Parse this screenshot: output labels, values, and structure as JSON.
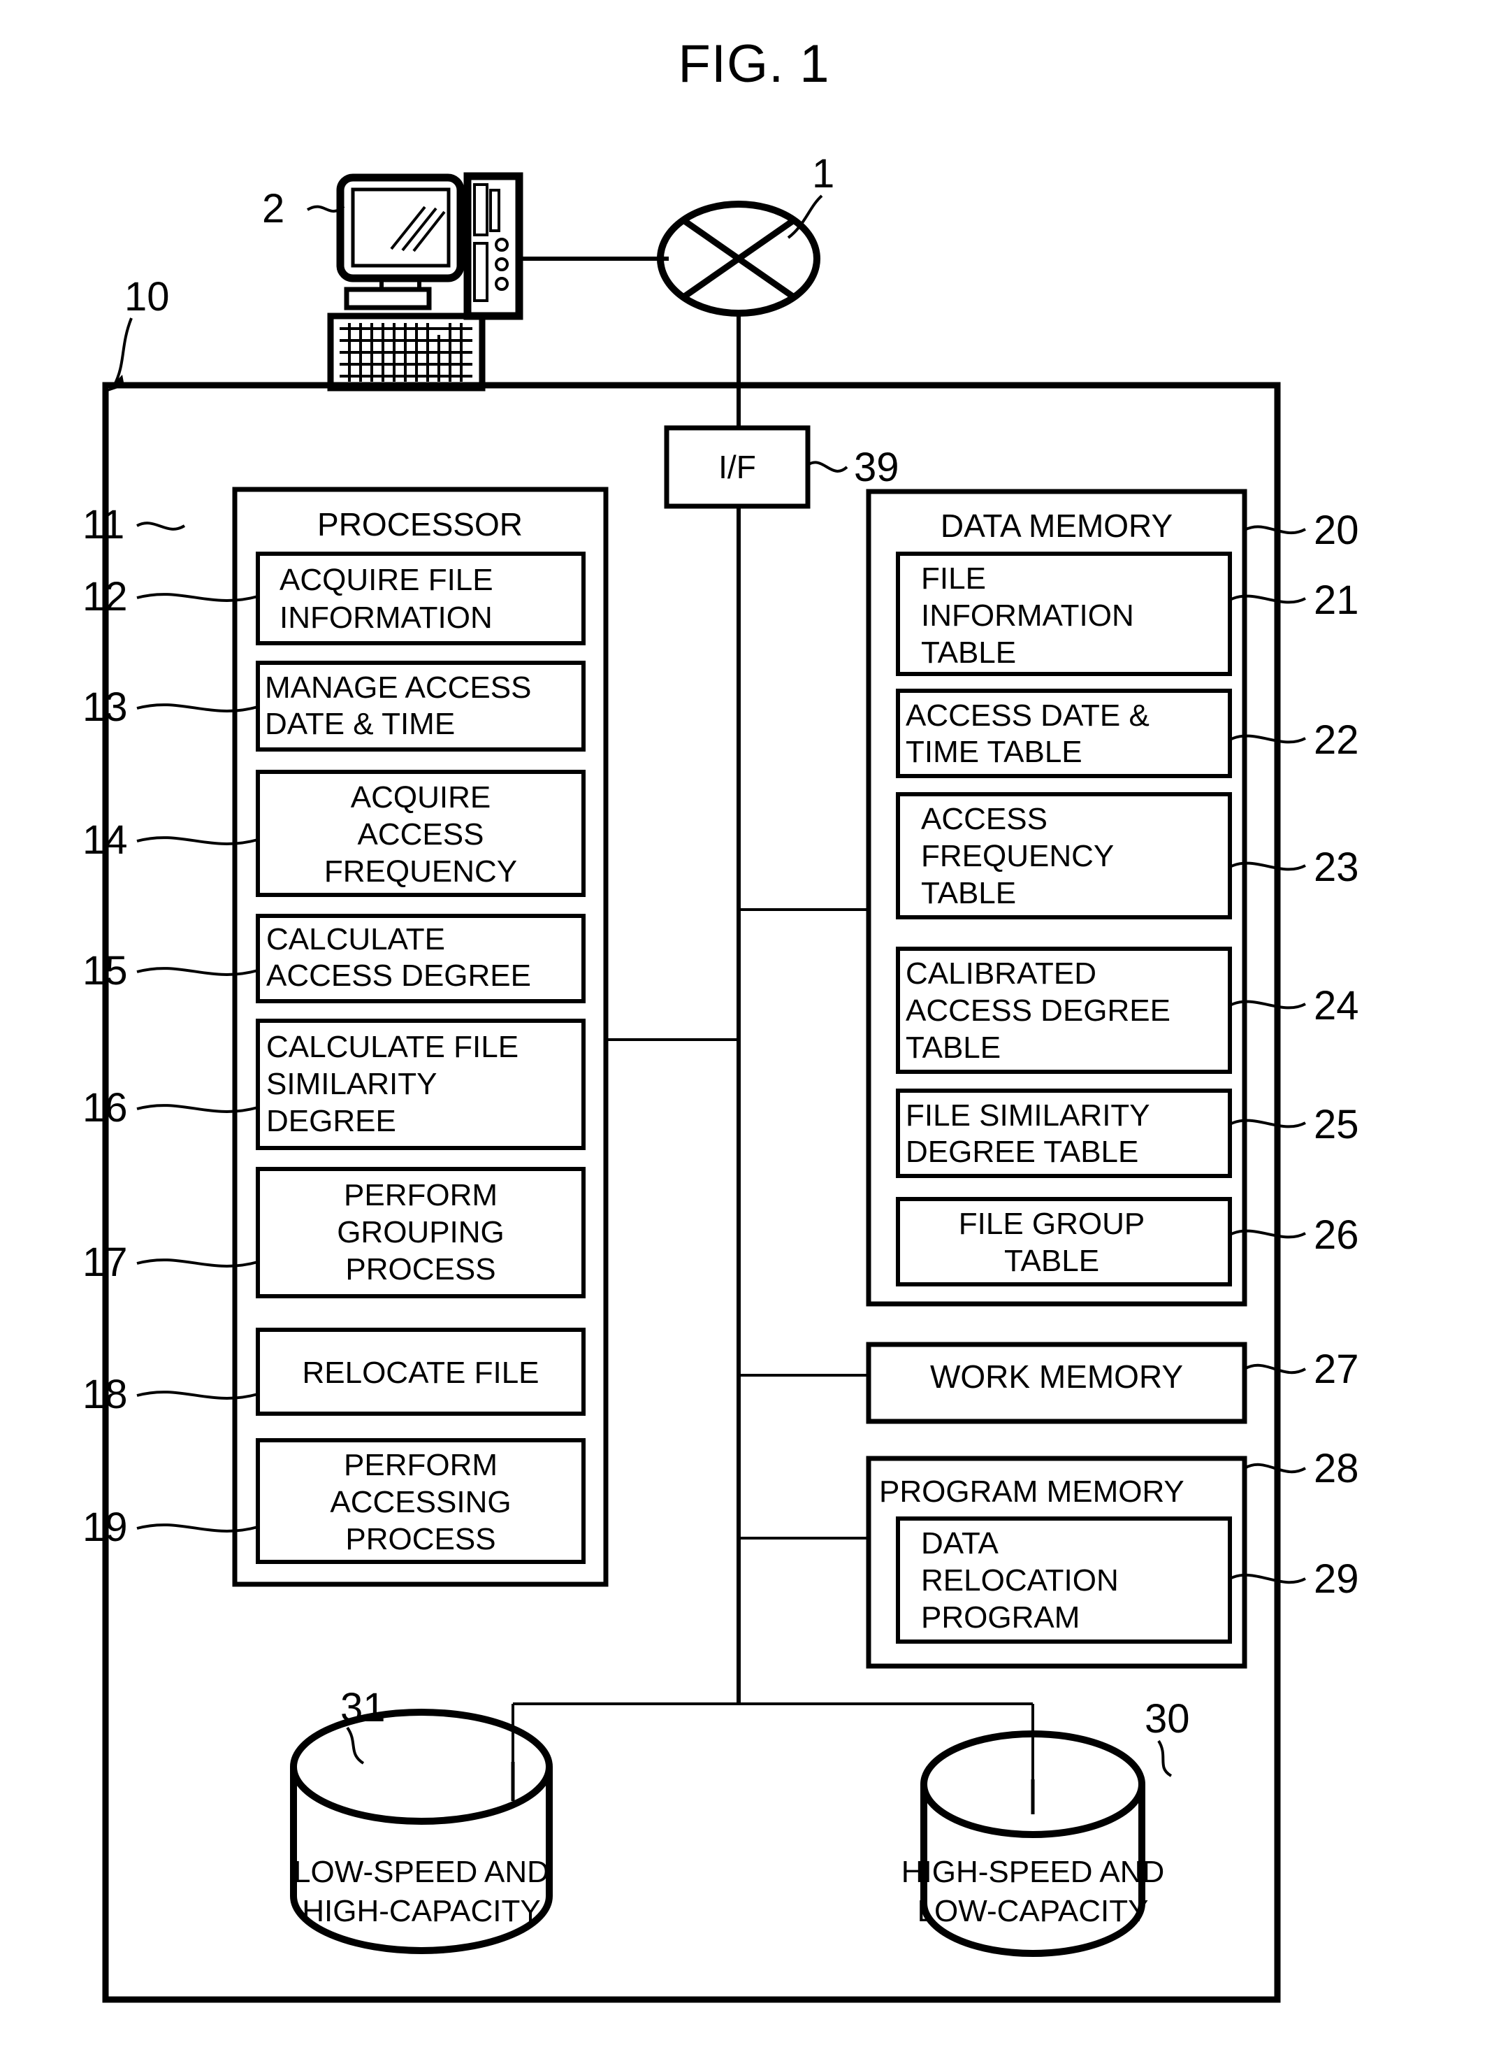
{
  "figure": {
    "title": "FIG. 1"
  },
  "refs": {
    "network": "1",
    "terminal": "2",
    "system": "10",
    "processor": "11",
    "acquire_file_information": "12",
    "manage_access_date_time": "13",
    "acquire_access_frequency": "14",
    "calculate_access_degree": "15",
    "calculate_file_similarity_degree": "16",
    "perform_grouping_process": "17",
    "relocate_file": "18",
    "perform_accessing_process": "19",
    "data_memory": "20",
    "file_information_table": "21",
    "access_date_time_table": "22",
    "access_frequency_table": "23",
    "calibrated_access_degree_table": "24",
    "file_similarity_degree_table": "25",
    "file_group_table": "26",
    "work_memory": "27",
    "program_memory": "28",
    "data_relocation_program": "29",
    "high_speed_storage": "30",
    "low_speed_storage": "31",
    "interface": "39"
  },
  "interface": {
    "label": "I/F"
  },
  "processor": {
    "heading": "PROCESSOR",
    "blocks": [
      {
        "ref": "12",
        "lines": [
          "ACQUIRE FILE",
          "INFORMATION"
        ],
        "align": "left"
      },
      {
        "ref": "13",
        "lines": [
          "MANAGE ACCESS",
          "DATE & TIME"
        ],
        "align": "left"
      },
      {
        "ref": "14",
        "lines": [
          "ACQUIRE",
          "ACCESS",
          "FREQUENCY"
        ],
        "align": "center"
      },
      {
        "ref": "15",
        "lines": [
          "CALCULATE",
          "ACCESS DEGREE"
        ],
        "align": "left"
      },
      {
        "ref": "16",
        "lines": [
          "CALCULATE FILE",
          "SIMILARITY",
          "DEGREE"
        ],
        "align": "left"
      },
      {
        "ref": "17",
        "lines": [
          "PERFORM",
          "GROUPING",
          "PROCESS"
        ],
        "align": "center"
      },
      {
        "ref": "18",
        "lines": [
          "RELOCATE FILE"
        ],
        "align": "center"
      },
      {
        "ref": "19",
        "lines": [
          "PERFORM",
          "ACCESSING",
          "PROCESS"
        ],
        "align": "center"
      }
    ]
  },
  "data_memory": {
    "heading": "DATA MEMORY",
    "blocks": [
      {
        "ref": "21",
        "lines": [
          "FILE",
          "INFORMATION",
          "TABLE"
        ],
        "align": "left"
      },
      {
        "ref": "22",
        "lines": [
          "ACCESS DATE &",
          "TIME TABLE"
        ],
        "align": "left"
      },
      {
        "ref": "23",
        "lines": [
          "ACCESS",
          "FREQUENCY",
          "TABLE"
        ],
        "align": "left"
      },
      {
        "ref": "24",
        "lines": [
          "CALIBRATED",
          "ACCESS DEGREE",
          "TABLE"
        ],
        "align": "left"
      },
      {
        "ref": "25",
        "lines": [
          "FILE SIMILARITY",
          "DEGREE TABLE"
        ],
        "align": "left"
      },
      {
        "ref": "26",
        "lines": [
          "FILE GROUP",
          "TABLE"
        ],
        "align": "center"
      }
    ]
  },
  "work_memory": {
    "label": "WORK MEMORY"
  },
  "program_memory": {
    "heading": "PROGRAM MEMORY",
    "block": {
      "ref": "29",
      "lines": [
        "DATA",
        "RELOCATION",
        "PROGRAM"
      ],
      "align": "left"
    }
  },
  "storage": {
    "low_speed": {
      "ref": "31",
      "lines": [
        "LOW-SPEED AND",
        "HIGH-CAPACITY"
      ]
    },
    "high_speed": {
      "ref": "30",
      "lines": [
        "HIGH-SPEED AND",
        "LOW-CAPACITY"
      ]
    }
  },
  "icons": {
    "network": "network-cloud-icon",
    "terminal": "computer-terminal-icon",
    "monitor": "monitor-icon",
    "keyboard": "keyboard-icon",
    "tower": "computer-tower-icon",
    "disk": "disk-cylinder-icon"
  },
  "colors": {
    "line": "#000000",
    "background": "#ffffff"
  }
}
